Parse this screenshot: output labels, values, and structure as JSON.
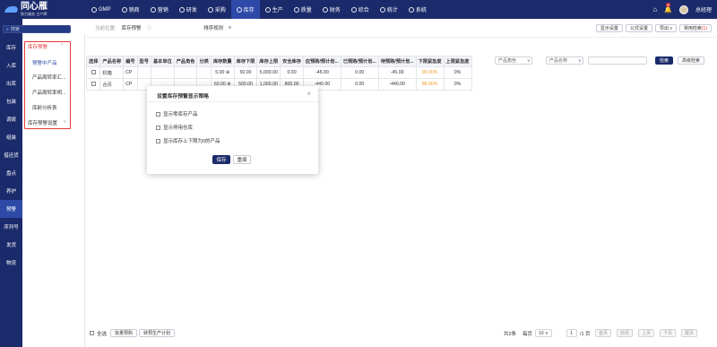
{
  "brand": {
    "name": "同心雁",
    "tagline": "致力服务·主产牌"
  },
  "nav": [
    {
      "label": "GMP",
      "icon": "gmp-icon"
    },
    {
      "label": "销商",
      "icon": "sales-icon"
    },
    {
      "label": "营销",
      "icon": "marketing-icon"
    },
    {
      "label": "研发",
      "icon": "rnd-icon"
    },
    {
      "label": "采购",
      "icon": "purchase-icon"
    },
    {
      "label": "库存",
      "icon": "inventory-icon"
    },
    {
      "label": "生产",
      "icon": "production-icon"
    },
    {
      "label": "质量",
      "icon": "quality-icon"
    },
    {
      "label": "财务",
      "icon": "finance-icon"
    },
    {
      "label": "综合",
      "icon": "general-icon"
    },
    {
      "label": "统计",
      "icon": "stats-icon"
    },
    {
      "label": "系统",
      "icon": "system-icon"
    }
  ],
  "user": {
    "name": "总经理",
    "notif_count": "8"
  },
  "search": {
    "placeholder": "搜索"
  },
  "sidebar": [
    "库存",
    "入库",
    "出库",
    "包装",
    "调拨",
    "组装",
    "借还货",
    "盘点",
    "养护",
    "预警",
    "序列号",
    "发货",
    "物流"
  ],
  "submenu": {
    "group1": "库存预警",
    "items": [
      "预警中产品",
      "产品周转率汇...",
      "产品周转率明...",
      "库龄分析表"
    ],
    "group2": "库存预警设置"
  },
  "crumb": {
    "label": "当前位置:",
    "page": "库存预警",
    "sort": "排序规则"
  },
  "topbuttons": {
    "display": "显示设置",
    "formula": "公式设置",
    "export": "导出",
    "common": "常用检索",
    "common_count": "(1)"
  },
  "filters": {
    "role": "产品角色",
    "name": "产品名称",
    "search": "检索",
    "advanced": "高级检索"
  },
  "table": {
    "headers": [
      "选择",
      "产品名称",
      "编号",
      "型号",
      "基本单位",
      "产品角色",
      "分类",
      "库存数量",
      "库存下限",
      "库存上限",
      "安全库存",
      "应预购/预计划...",
      "已预购/预计划...",
      "待预购/预计划...",
      "下限紧急度",
      "上限紧急度"
    ],
    "rows": [
      {
        "name": "机箱",
        "code": "CP",
        "qty": "5.00",
        "low": "50.00",
        "high": "5,000.00",
        "safe": "0.00",
        "should": "-45.00",
        "done": "0.00",
        "wait": "-45.00",
        "lowurg": "90.00%",
        "highurg": "0%"
      },
      {
        "name": "合页",
        "code": "CP",
        "qty": "60.00",
        "low": "500.00",
        "high": "1,000.00",
        "safe": "800.00",
        "should": "-440.00",
        "done": "0.00",
        "wait": "-440.00",
        "lowurg": "88.00%",
        "highurg": "0%"
      }
    ]
  },
  "modal": {
    "title": "设置库存预警显示策略",
    "options": [
      "显示零库存产品",
      "显示停用仓库",
      "显示库存上下限为0的产品"
    ],
    "save": "保存",
    "reset": "重填"
  },
  "footer": {
    "selectall": "全选",
    "batch": "批量预购",
    "convert": "转预生产计划",
    "total": "共2条",
    "perpage_label": "每页",
    "perpage": "10",
    "goto": "1",
    "pages": "/1 页",
    "first": "首页",
    "prev": "前页",
    "up": "上页",
    "next": "下页",
    "last": "尾页"
  }
}
